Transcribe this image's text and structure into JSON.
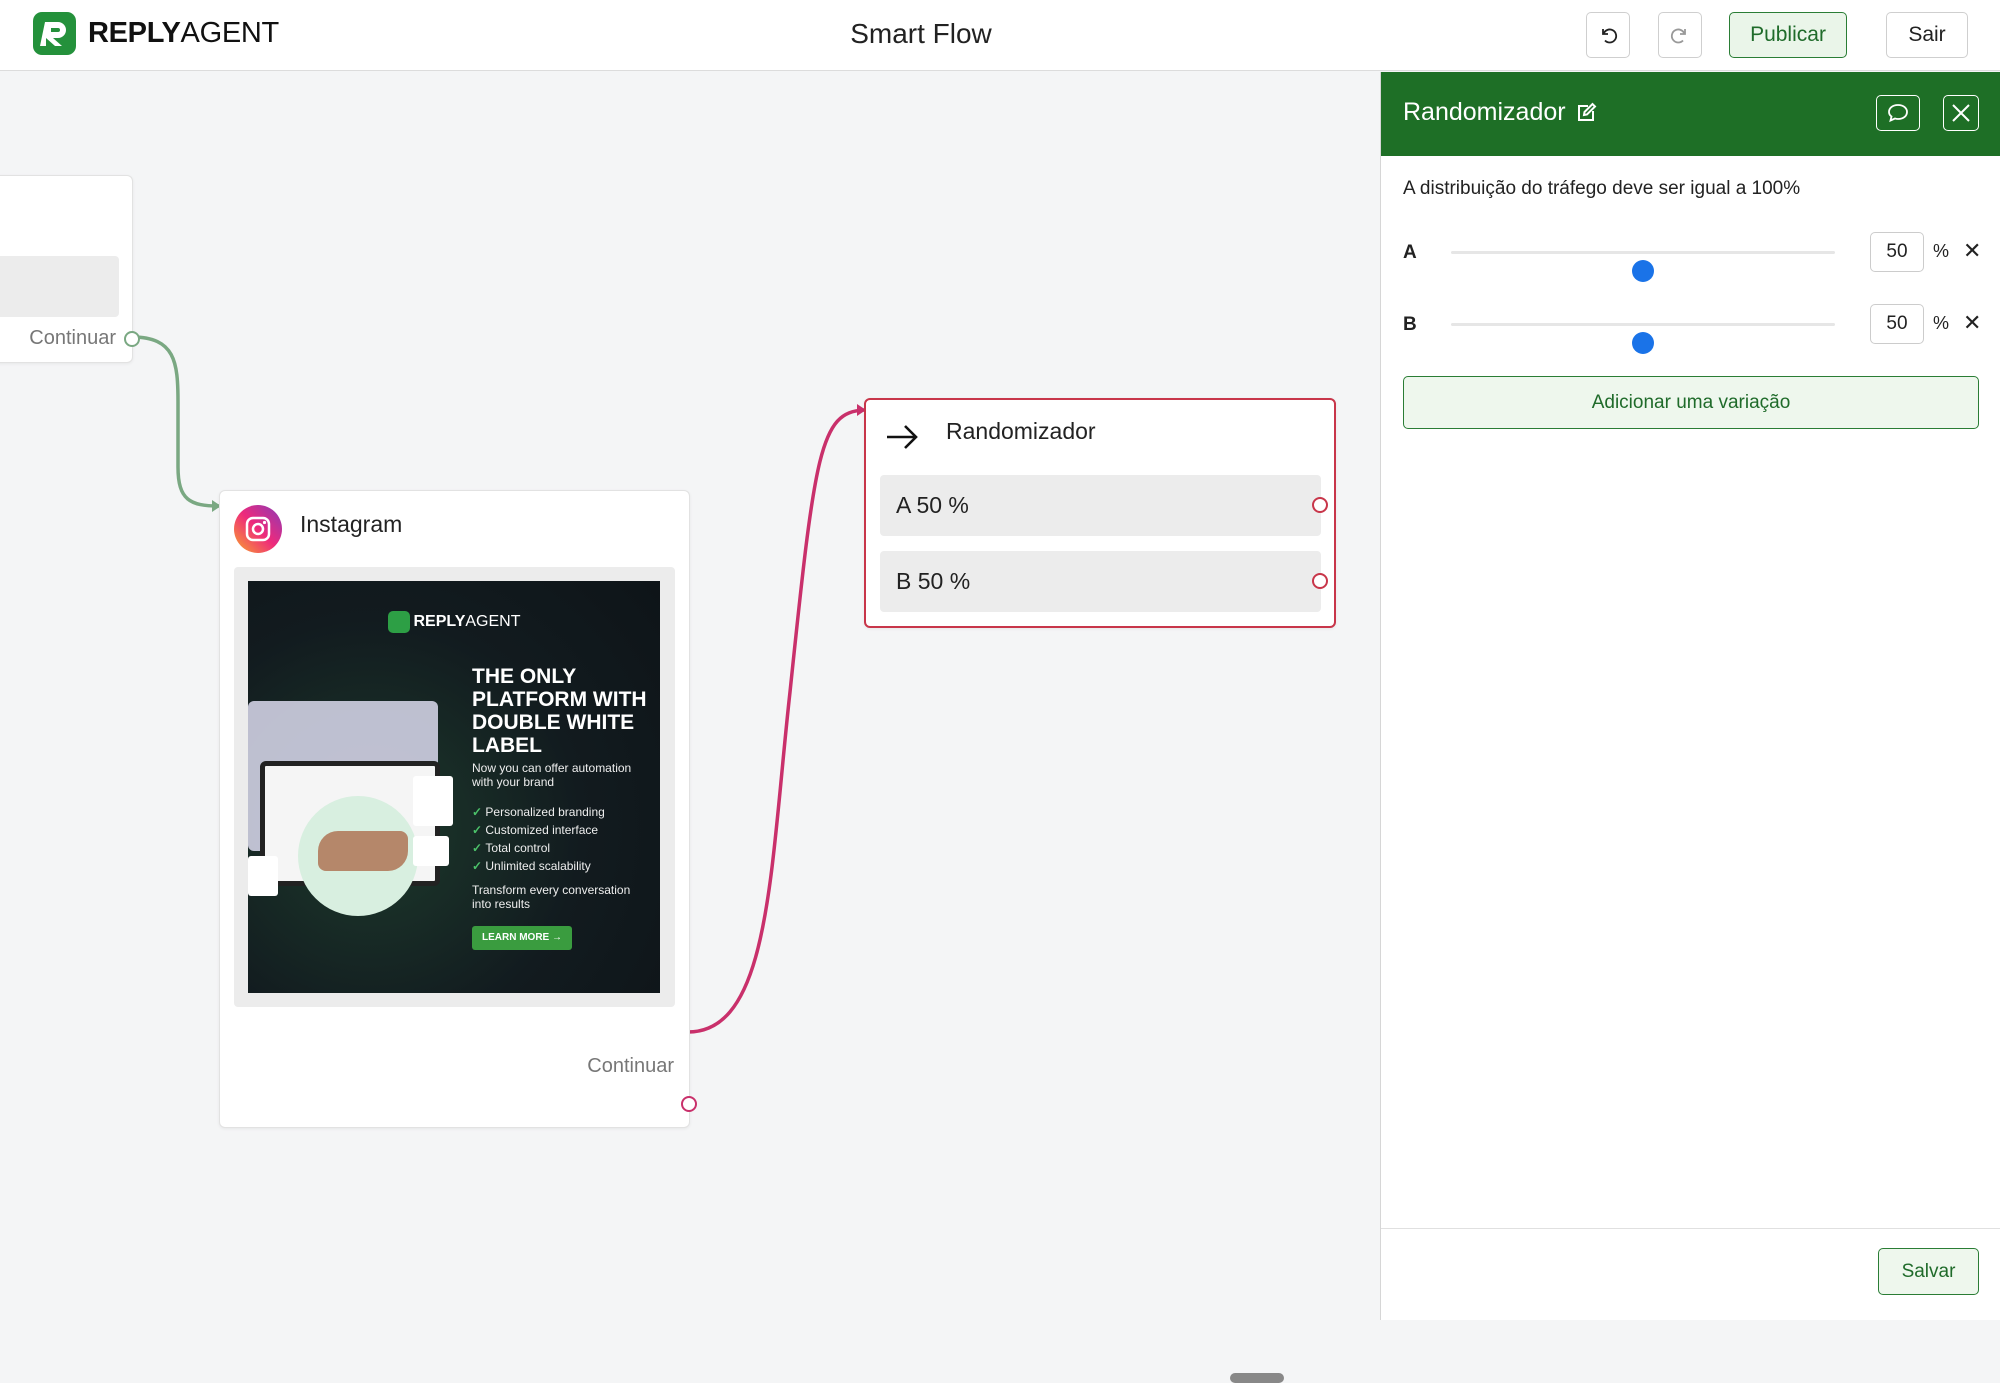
{
  "header": {
    "logo_bold": "REPLY",
    "logo_regular": "AGENT",
    "title": "Smart Flow",
    "undo_icon": "undo-icon",
    "redo_icon": "redo-icon",
    "publish_label": "Publicar",
    "exit_label": "Sair"
  },
  "canvas": {
    "previous_node": {
      "output_label": "Continuar"
    },
    "instagram_node": {
      "title": "Instagram",
      "icon": "instagram-icon",
      "output_label": "Continuar",
      "image": {
        "brand_bold": "REPLY",
        "brand_regular": "AGENT",
        "headline": "THE ONLY PLATFORM WITH DOUBLE WHITE LABEL",
        "subtitle": "Now you can offer automation with your brand",
        "features": [
          "Personalized branding",
          "Customized interface",
          "Total control",
          "Unlimited scalability"
        ],
        "footer": "Transform every conversation into results",
        "cta": "LEARN MORE →"
      }
    },
    "randomizer_node": {
      "title": "Randomizador",
      "icon": "arrow-right-icon",
      "variations": [
        {
          "label": "A 50 %"
        },
        {
          "label": "B 50 %"
        }
      ]
    },
    "edge_colors": {
      "green": "#7aa882",
      "pink": "#c9306b"
    }
  },
  "panel": {
    "title": "Randomizador",
    "description": "A distribuição do tráfego deve ser igual a 100%",
    "variations": [
      {
        "name": "A",
        "value": "50",
        "percent": 50,
        "unit": "%"
      },
      {
        "name": "B",
        "value": "50",
        "percent": 50,
        "unit": "%"
      }
    ],
    "add_variation_label": "Adicionar uma variação",
    "save_label": "Salvar"
  },
  "colors": {
    "brand_green": "#1e6f26",
    "accent_blue": "#1a73e8",
    "node_selected_border": "#c8364a"
  }
}
